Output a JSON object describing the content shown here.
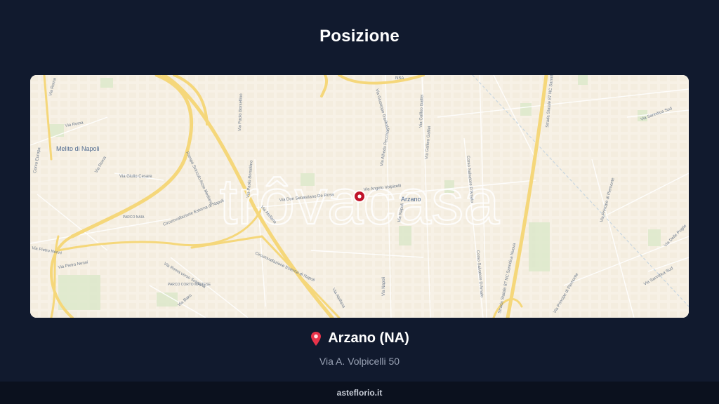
{
  "header": {
    "title": "Posizione"
  },
  "map": {
    "watermark": "trôvacasa",
    "labels": {
      "melito": "Melito di Napoli",
      "arzano": "Arzano",
      "via_roma": "Via Roma",
      "corso_europa": "Corso Europa",
      "via_giulio_cesare": "Via Giulio Cesare",
      "parco_naia": "PARCO NAIA",
      "via_pietro_nenni": "Via Pietro Nenni",
      "via_pietro_nenni_2": "Via Pietro Nenni",
      "via_roma_verso_scampia": "Via Roma verso Scampia",
      "parco_corto": "PARCO CORTO MALTESE",
      "via_bakù": "Via Bakù",
      "circ_1": "Circumvallazione Esterna di Napoli",
      "circ_2": "Circumvallazione Esterna di Napoli",
      "via_paolo_borsellino": "Via Paolo Borsellino",
      "via_paolo_borsellino_2": "Via Paolo Borsellino",
      "via_don_sebastiano": "Via Don Sebastiano De Rosa",
      "via_angelo": "Via Angelo Volpicelli",
      "via_atellana": "Via Atellana",
      "via_atellana_2": "Via Atellana",
      "via_alfredo_pecchia": "Via Alfredo Pecchia",
      "via_napoli": "Via Napoli",
      "via_napoli_2": "Via Napoli",
      "via_galileo": "Via Galileo Galilei",
      "via_galileo_2": "Via Galileo Galilei",
      "via_giuseppe_garibaldi": "Via Giuseppe Garibaldi",
      "corso_salvatore": "Corso Salvatore D'Amato",
      "corso_salvatore_2": "Corso Salvatore D'Amato",
      "strada_statale": "Strada Statale 87 NC Sannitica Nuova",
      "strada_statale_2": "Strada Statale 87 NC Sannitica",
      "via_sannitica_sud": "Via Sannitica Sud",
      "via_principe": "Via Principe di Piemonte",
      "via_principe_2": "Via Principe di Piemonte",
      "via_delle_puglie": "Via Delle Puglie",
      "via_sannitica_sud_2": "Via Sannitica Sud",
      "nsa": "NSA",
      "via_roma_2": "Via Roma",
      "via_roma_3": "Via Roma",
      "rampa": "Rampa Svincolo Asse Mediano"
    }
  },
  "location": {
    "icon": "pin-icon",
    "name": "Arzano (NA)",
    "address": "Via A. Volpicelli 50"
  },
  "footer": {
    "site": "asteflorio.it"
  },
  "colors": {
    "background": "#111a2e",
    "map_land": "#f7f1e6",
    "major_road": "#f5d77a",
    "marker": "#c0142a"
  }
}
